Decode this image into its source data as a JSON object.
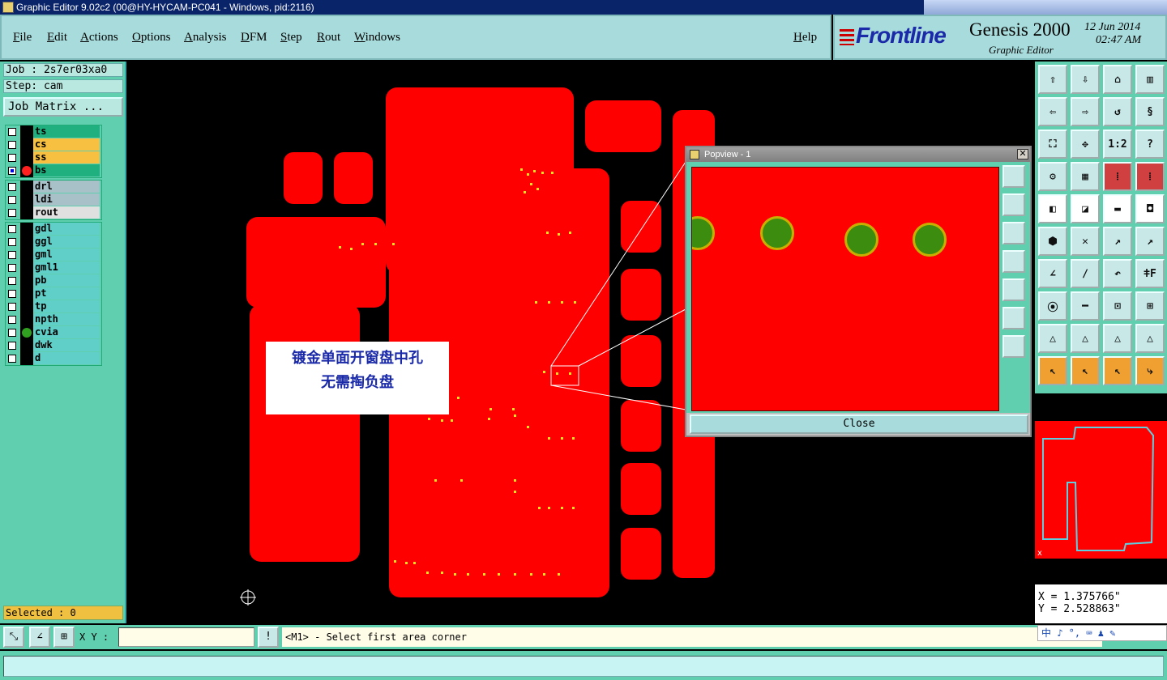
{
  "window": {
    "title": "Graphic Editor 9.02c2 (00@HY-HYCAM-PC041 - Windows, pid:2116)"
  },
  "menu": {
    "items": [
      "File",
      "Edit",
      "Actions",
      "Options",
      "Analysis",
      "DFM",
      "Step",
      "Rout",
      "Windows"
    ],
    "help": "Help"
  },
  "logo": {
    "brand": "Frontline",
    "product": "Genesis 2000",
    "subtitle": "Graphic Editor",
    "date": "12 Jun 2014",
    "time": "02:47 AM"
  },
  "job": {
    "job_label": "Job : 2s7er03xa0",
    "step_label": "Step: cam",
    "matrix_button": "Job Matrix ..."
  },
  "layers_group1": [
    {
      "name": "ts",
      "color": "#20b080",
      "checked": false
    },
    {
      "name": "cs",
      "color": "#f8c040",
      "checked": false
    },
    {
      "name": "ss",
      "color": "#f8c040",
      "checked": false
    },
    {
      "name": "bs",
      "color": "#20b080",
      "checked": true,
      "dot": "#ff2020"
    }
  ],
  "layers_group2": [
    {
      "name": "drl",
      "color": "#a8c0c8",
      "checked": false
    },
    {
      "name": "ldi",
      "color": "#a8c0c8",
      "checked": false
    },
    {
      "name": "rout",
      "color": "#e0e0e0",
      "checked": false
    }
  ],
  "layers_group3": [
    {
      "name": "gdl",
      "color": "#5fcfc8",
      "checked": false
    },
    {
      "name": "ggl",
      "color": "#5fcfc8",
      "checked": false
    },
    {
      "name": "gml",
      "color": "#5fcfc8",
      "checked": false
    },
    {
      "name": "gml1",
      "color": "#5fcfc8",
      "checked": false
    },
    {
      "name": "pb",
      "color": "#5fcfc8",
      "checked": false
    },
    {
      "name": "pt",
      "color": "#5fcfc8",
      "checked": false
    },
    {
      "name": "tp",
      "color": "#5fcfc8",
      "checked": false
    },
    {
      "name": "npth",
      "color": "#5fcfc8",
      "checked": false
    },
    {
      "name": "cvia",
      "color": "#5fcfc8",
      "checked": false,
      "dot": "#30a020"
    },
    {
      "name": "dwk",
      "color": "#5fcfc8",
      "checked": false
    },
    {
      "name": "d",
      "color": "#5fcfc8",
      "checked": false
    }
  ],
  "selected": "Selected : 0",
  "annotation": {
    "line1": "镀金单面开窗盘中孔",
    "line2": "无需掏负盘"
  },
  "popview": {
    "title": "Popview - 1",
    "close_label": "Close"
  },
  "coords": {
    "x": "X = 1.375766\"",
    "y": "Y = 2.528863\""
  },
  "cmd": {
    "xy_label": "X Y :",
    "prompt": "<M1> - Select first area corner"
  },
  "ime": {
    "text": "中 ♪ °, ⌨ ♟ ✎"
  },
  "colors": {
    "accent": "#5fcfb0",
    "board": "#ff0000",
    "pad": "#3c8c10"
  }
}
